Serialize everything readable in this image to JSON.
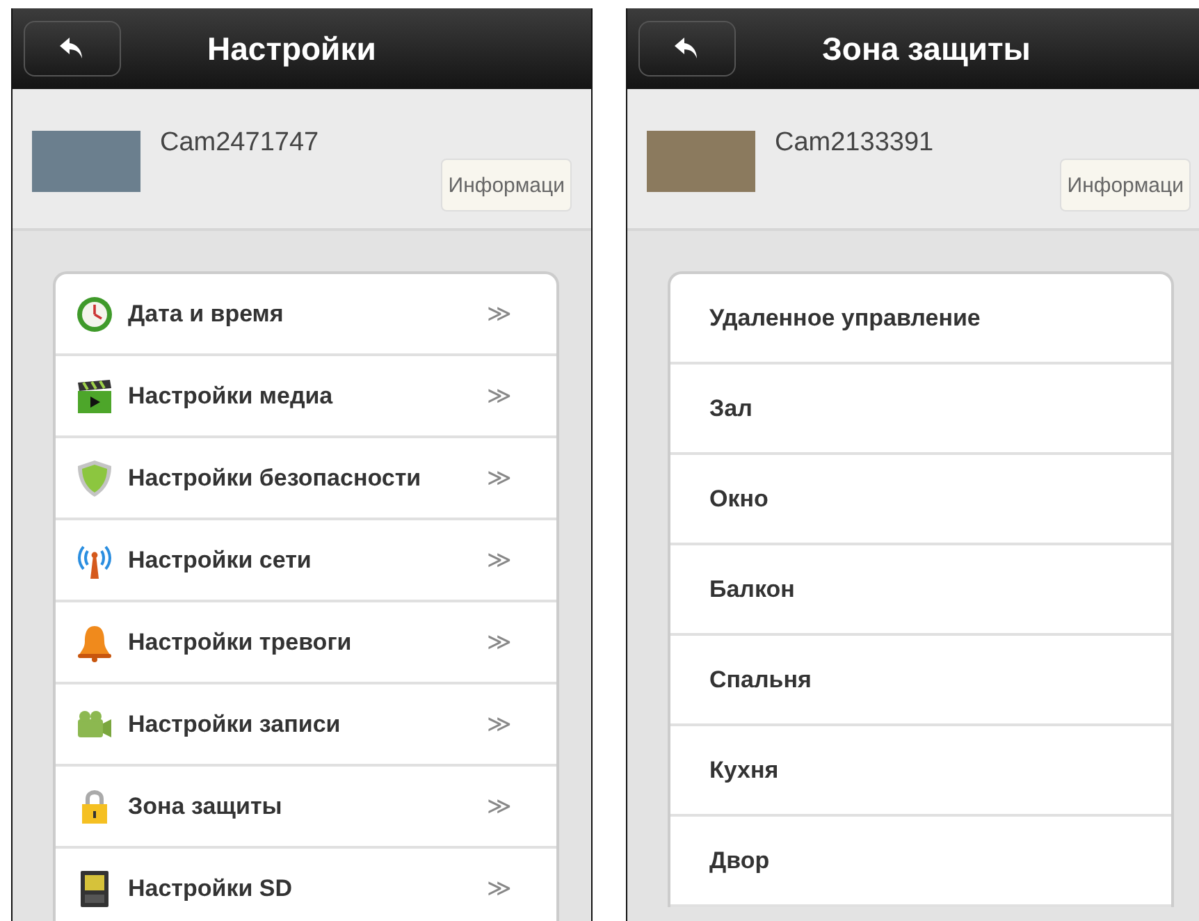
{
  "screens": [
    {
      "title": "Настройки",
      "camera_name": "Cam2471747",
      "info_button": "Информаци",
      "items": [
        {
          "kind": "icon-row",
          "label": "Дата и время",
          "arrow": "≫"
        },
        {
          "kind": "icon-row",
          "label": "Настройки медиа",
          "arrow": "≫"
        },
        {
          "kind": "icon-row",
          "label": "Настройки безопасности",
          "arrow": "≫"
        },
        {
          "kind": "icon-row",
          "label": "Настройки сети",
          "arrow": "≫"
        },
        {
          "kind": "icon-row",
          "label": "Настройки тревоги",
          "arrow": "≫"
        },
        {
          "kind": "icon-row",
          "label": "Настройки записи",
          "arrow": "≫"
        },
        {
          "kind": "icon-row",
          "label": "Зона защиты",
          "arrow": "≫"
        },
        {
          "kind": "icon-row",
          "label": "Настройки SD",
          "arrow": "≫"
        }
      ]
    },
    {
      "title": "Зона защиты",
      "camera_name": "Cam2133391",
      "info_button": "Информаци",
      "items": [
        {
          "kind": "plain-row",
          "label": "Удаленное управление"
        },
        {
          "kind": "plain-row",
          "label": "Зал"
        },
        {
          "kind": "plain-row",
          "label": "Окно"
        },
        {
          "kind": "plain-row",
          "label": "Балкон"
        },
        {
          "kind": "plain-row",
          "label": "Спальня"
        },
        {
          "kind": "plain-row",
          "label": "Кухня"
        },
        {
          "kind": "plain-row",
          "label": "Двор"
        }
      ]
    }
  ]
}
